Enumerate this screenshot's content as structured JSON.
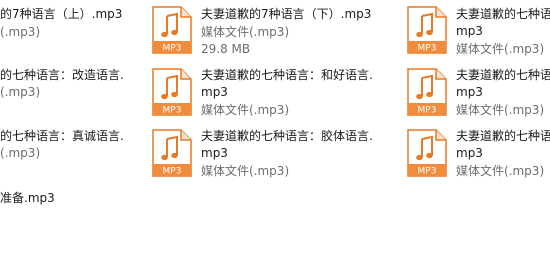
{
  "colors": {
    "icon_orange": "#F08C3C",
    "icon_orange_dark": "#E57A27",
    "text": "#1b1b1b",
    "meta": "#6d6d6d"
  },
  "icon_name": "music-note-icon",
  "icon_badge": "MP3",
  "files": {
    "c1r1": {
      "name": "的7种语言（上）.mp3",
      "meta": "(.mp3)"
    },
    "c1r2": {
      "name": "的七种语言：改造语言.",
      "meta": "(.mp3)"
    },
    "c1r3": {
      "name": "的七种语言：真诚语言.",
      "meta": "(.mp3)"
    },
    "c1r4": {
      "name": "准备.mp3"
    },
    "c2r1": {
      "name": "夫妻道歉的7种语言（下）.mp3",
      "meta": "29.8 MB"
    },
    "c2r2": {
      "name1": "夫妻道歉的七种语言：和好语言.",
      "name2": "mp3",
      "meta": "媒体文件(.mp3)"
    },
    "c2r3": {
      "name1": "夫妻道歉的七种语言：胶体语言.",
      "name2": "mp3",
      "meta": "媒体文件(.mp3)"
    },
    "c3r1": {
      "name": "夫妻道歉的七种语",
      "name2": "mp3",
      "meta": "媒体文件(.mp3)"
    },
    "c3r2": {
      "name": "夫妻道歉的七种语",
      "name2": "mp3",
      "meta": "媒体文件(.mp3)"
    },
    "c3r3": {
      "name": "夫妻道歉的七种语",
      "name2": "mp3",
      "meta": "媒体文件(.mp3)"
    },
    "c2r1_type": "媒体文件(.mp3)"
  }
}
